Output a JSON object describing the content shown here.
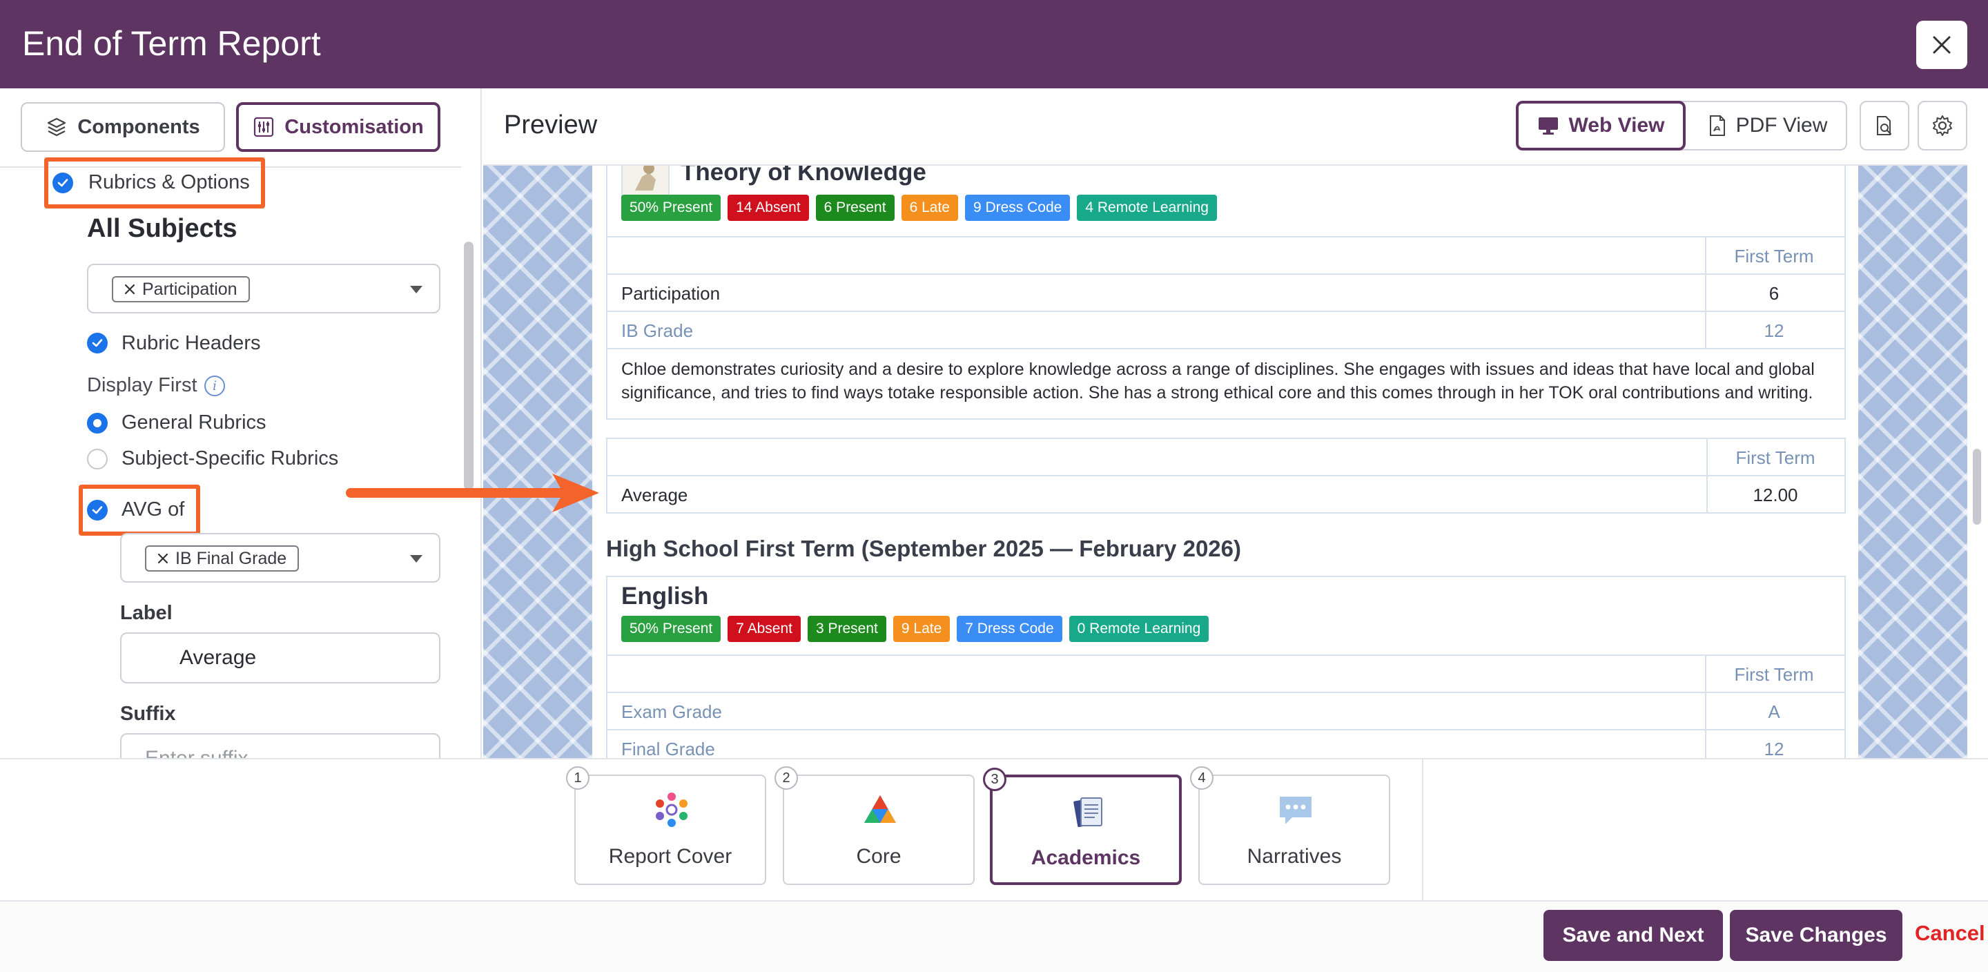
{
  "header": {
    "title": "End of Term Report"
  },
  "left_panel": {
    "tabs": {
      "components": "Components",
      "customisation": "Customisation"
    },
    "rubrics_options": "Rubrics & Options",
    "all_subjects": "All Subjects",
    "participation_chip": "Participation",
    "rubric_headers": "Rubric Headers",
    "display_first": "Display First",
    "general_rubrics": "General Rubrics",
    "subject_specific_rubrics": "Subject-Specific Rubrics",
    "avg_of": "AVG of",
    "ib_final_grade_chip": "IB Final Grade",
    "label_title": "Label",
    "label_value": "Average",
    "suffix_title": "Suffix",
    "suffix_placeholder": "Enter suffix"
  },
  "preview": {
    "title": "Preview",
    "web_view": "Web View",
    "pdf_view": "PDF View",
    "tok": {
      "title": "Theory of Knowledge",
      "badges": [
        "50% Present",
        "14 Absent",
        "6 Present",
        "6 Late",
        "9 Dress Code",
        "4 Remote Learning"
      ],
      "term_header": "First Term",
      "rows": [
        {
          "label": "Participation",
          "value": "6"
        },
        {
          "label": "IB Grade",
          "value": "12"
        }
      ],
      "narrative": "Chloe demonstrates curiosity and a desire to explore knowledge across a range of disciplines. She engages with issues and ideas that have local and global significance, and tries to find ways totake responsible action. She has a strong ethical core and this comes through in her TOK oral contributions and writing."
    },
    "average_table": {
      "term_header": "First Term",
      "label": "Average",
      "value": "12.00"
    },
    "section_heading": "High School First Term (September 2025 — February 2026)",
    "english": {
      "title": "English",
      "badges": [
        "50% Present",
        "7 Absent",
        "3 Present",
        "9 Late",
        "7 Dress Code",
        "0 Remote Learning"
      ],
      "term_header": "First Term",
      "rows": [
        {
          "label": "Exam Grade",
          "value": "A"
        },
        {
          "label": "Final Grade",
          "value": "12"
        }
      ]
    }
  },
  "badge_colors": [
    "#2aa140",
    "#d0101c",
    "#1d8a1d",
    "#f5901f",
    "#3a8df5",
    "#18a88a"
  ],
  "steps": [
    {
      "num": "1",
      "label": "Report Cover"
    },
    {
      "num": "2",
      "label": "Core"
    },
    {
      "num": "3",
      "label": "Academics"
    },
    {
      "num": "4",
      "label": "Narratives"
    }
  ],
  "footer": {
    "save_next": "Save and Next",
    "save_changes": "Save Changes",
    "cancel": "Cancel"
  }
}
